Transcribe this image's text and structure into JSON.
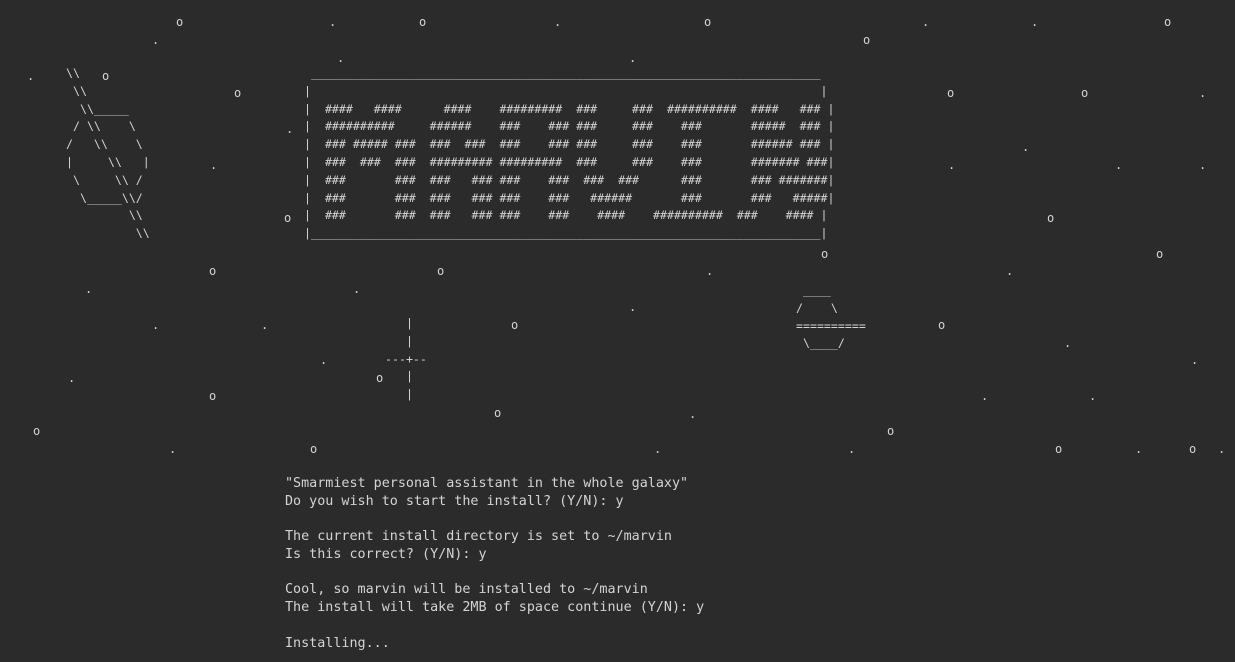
{
  "terminal": {
    "background": "#2b2b2b",
    "foreground": "#d4d4d4",
    "stars": [
      "o",
      ".",
      "o",
      ".",
      "o",
      ".",
      ".",
      "o",
      ".",
      "o",
      ".",
      ".",
      ".",
      "o",
      ".",
      "o",
      "o",
      ".",
      "o",
      "o",
      ".",
      ".",
      "o",
      ".",
      ".",
      ".",
      "o",
      "o",
      "o",
      ".",
      ".",
      ".",
      ".",
      ".",
      ".",
      ".",
      ".",
      "o",
      "o",
      "o",
      ".",
      ".",
      ".",
      ".",
      "o",
      ".",
      ".",
      ".",
      ".",
      "o",
      ".",
      "o",
      "o",
      ".",
      "o",
      "o",
      ".",
      "o",
      "o"
    ],
    "art": {
      "ship_left": "\\\\\n \\\\\n  \\\\_____\n / \\\\    \\\n/   \\\\    \\\n|     \\\\   |\n \\     \\\\ /\n  \\_____\\\\/\n         \\\\\n          \\\\",
      "banner": " _________________________________________________________________________\n|                                                                         |\n|  ####   ####      ####    #########  ###     ###  ##########  ####   ### |\n|  ##########     ######    ###    ### ###     ###    ###       #####  ### |\n|  ### ##### ###  ###  ###  ###    ### ###     ###    ###       ###### ### |\n|  ###  ###  ###  ######### #########  ###     ###    ###       ####### ###|\n|  ###       ###  ###   ### ###    ###  ###  ###      ###       ### #######|\n|  ###       ###  ###   ### ###    ###   ######       ###       ###   #####|\n|  ###       ###  ###   ### ###    ###    ####    ##########  ###    #### |\n|_________________________________________________________________________|",
      "crosshair": "   |\n   |\n---+--\n   |\n   |",
      "ufo": " ____\n/    \\\n==========\n \\____/"
    },
    "output_lines": [
      "\"Smarmiest personal assistant in the whole galaxy\"",
      "Do you wish to start the install? (Y/N): y",
      "",
      "The current install directory is set to ~/marvin",
      "Is this correct? (Y/N): y",
      "",
      "Cool, so marvin will be installed to ~/marvin",
      "The install will take 2MB of space continue (Y/N): y",
      "",
      "Installing..."
    ]
  }
}
